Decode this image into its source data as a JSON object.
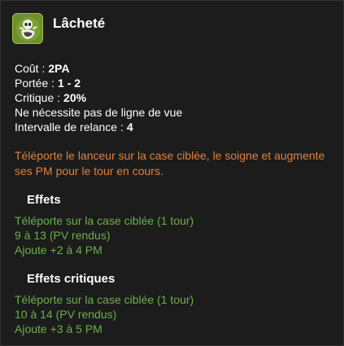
{
  "spell": {
    "name": "Lâcheté",
    "icon": "cowardice-spell-icon"
  },
  "stats": {
    "cost_label": "Coût :",
    "cost_value": "2PA",
    "range_label": "Portée :",
    "range_value": "1 - 2",
    "critical_label": "Critique :",
    "critical_value": "20%",
    "line_of_sight": "Ne nécessite pas de ligne de vue",
    "cooldown_label": "Intervalle de relance :",
    "cooldown_value": "4"
  },
  "description": "Téléporte le lanceur sur la case ciblée, le soigne et augmente ses PM pour le tour en cours.",
  "effects": {
    "title": "Effets",
    "lines": [
      "Téléporte sur la case ciblée (1 tour)",
      "9 à 13 (PV rendus)",
      "Ajoute +2 à 4 PM"
    ]
  },
  "critical_effects": {
    "title": "Effets critiques",
    "lines": [
      "Téléporte sur la case ciblée (1 tour)",
      "10 à 14 (PV rendus)",
      "Ajoute +3 à 5 PM"
    ]
  },
  "colors": {
    "description": "#e0803a",
    "effects": "#6ab04c",
    "icon_background": "#6d8f2c"
  }
}
